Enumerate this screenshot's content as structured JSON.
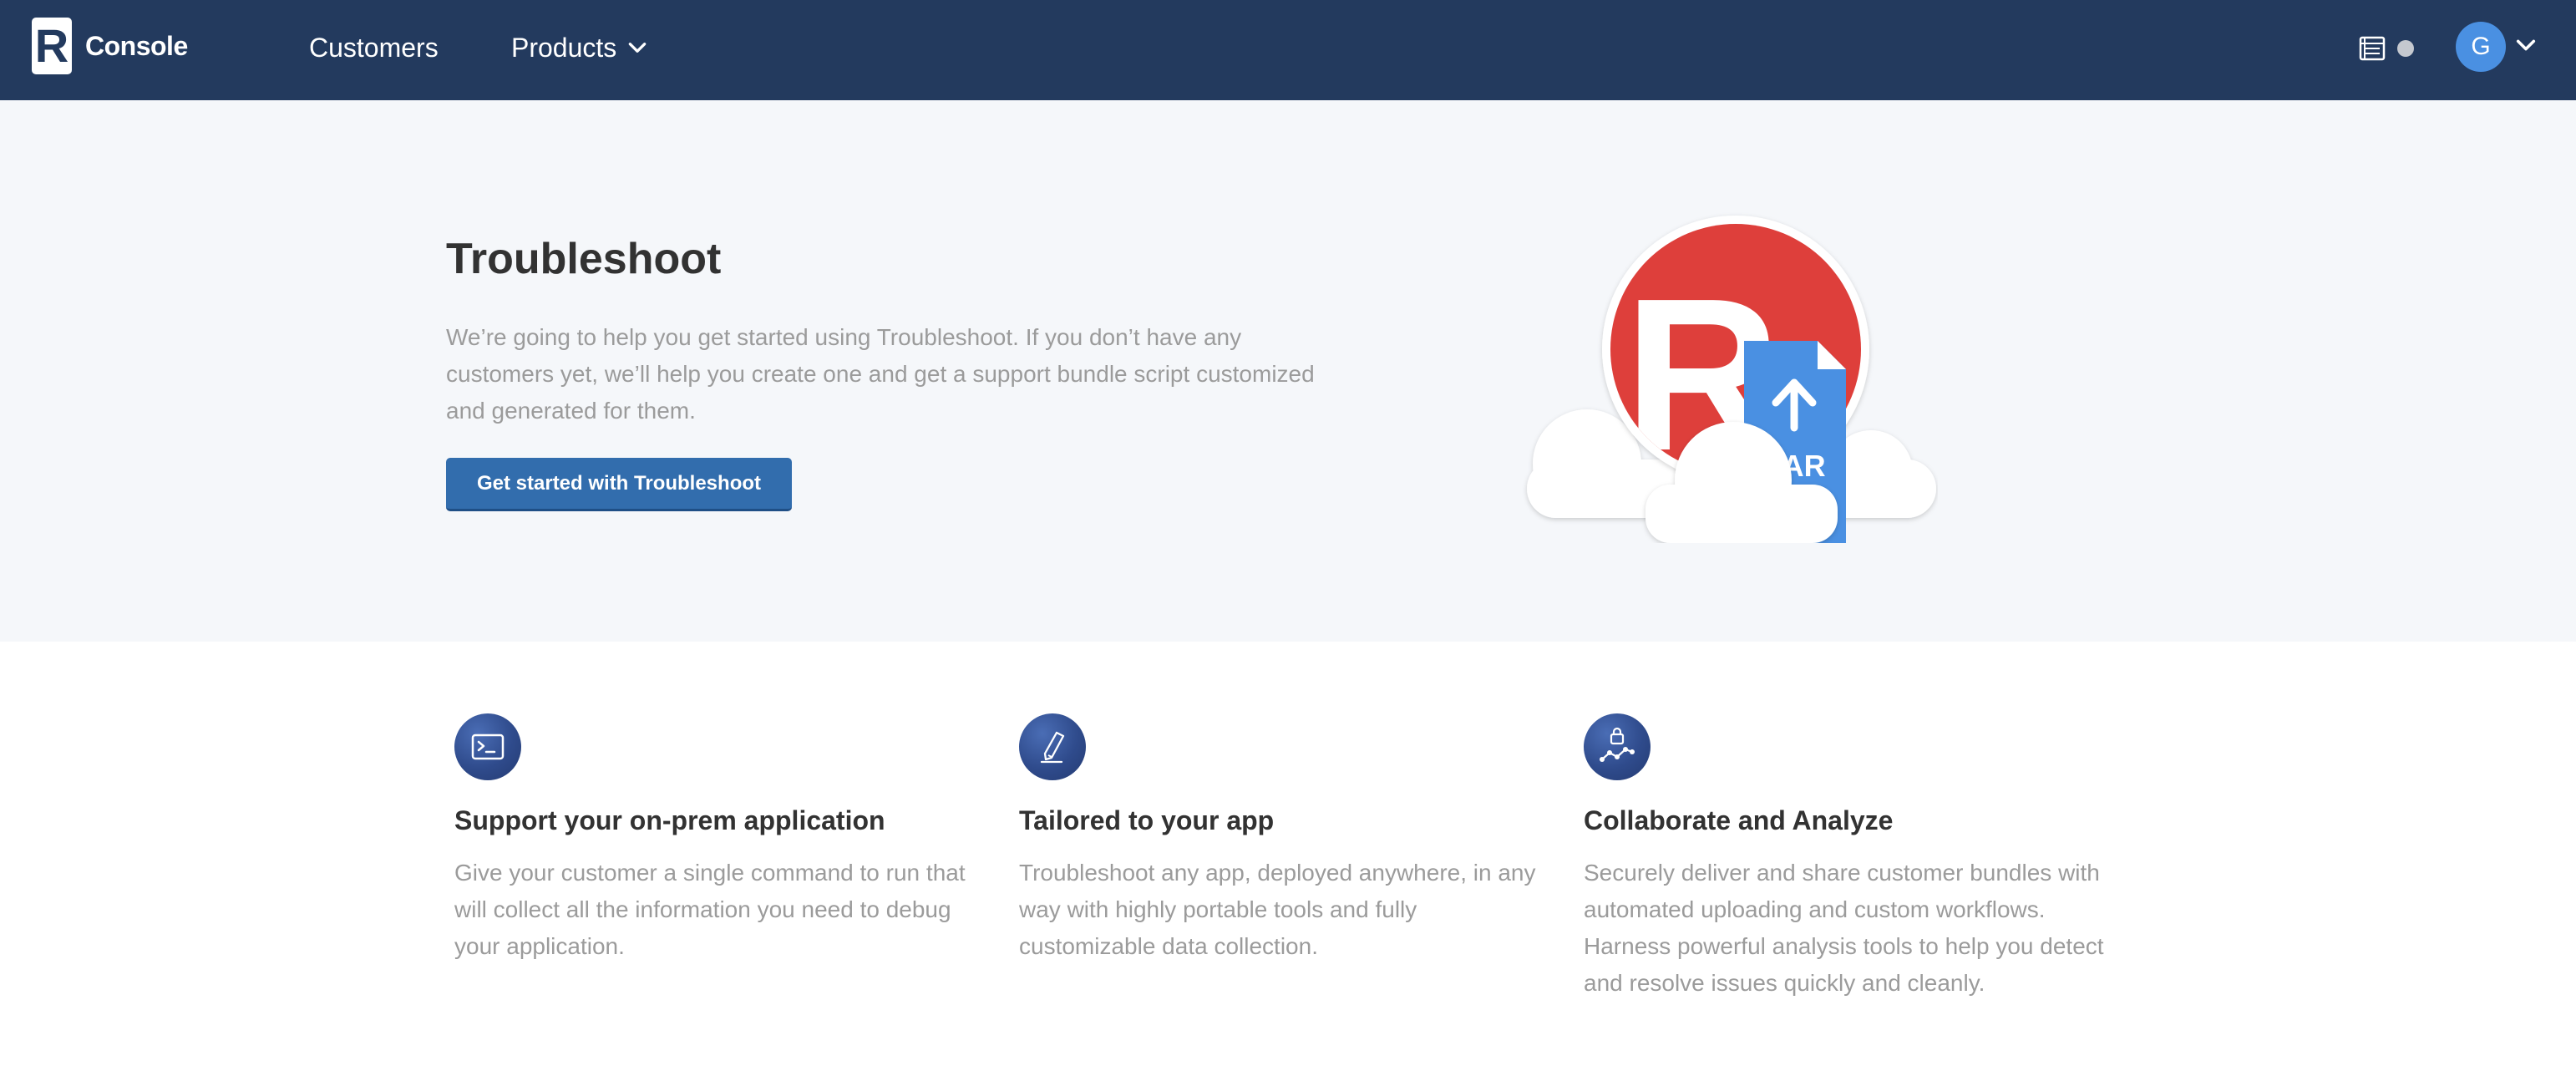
{
  "header": {
    "logo_letter": "R",
    "app_name": "Console",
    "nav": [
      {
        "label": "Customers"
      },
      {
        "label": "Products"
      }
    ],
    "user_initial": "G",
    "icons": [
      "support-bundle-icon",
      "notification-dot",
      "chevron-down-icon"
    ]
  },
  "hero": {
    "title": "Troubleshoot",
    "description": "We’re going to help you get started using Troubleshoot. If you don’t have any customers yet, we’ll help you create one and get a support bundle script customized and generated for them.",
    "button_label": "Get started with Troubleshoot",
    "illustration": {
      "badge_letter": "R",
      "file_label": "TAR",
      "colors": {
        "badge": "#de3f3b",
        "file": "#4a90e2"
      }
    }
  },
  "features": [
    {
      "icon": "terminal-icon",
      "title": "Support your on-prem application",
      "description": "Give your customer a single command to run that will collect all the information you need to debug your application."
    },
    {
      "icon": "pencil-icon",
      "title": "Tailored to your app",
      "description": "Troubleshoot any app, deployed anywhere, in any way with highly portable tools and fully customizable data collection."
    },
    {
      "icon": "secure-analytics-icon",
      "title": "Collaborate and Analyze",
      "description": "Securely deliver and share customer bundles with automated uploading and custom workflows. Harness powerful analysis tools to help you detect and resolve issues quickly and cleanly."
    }
  ],
  "colors": {
    "topbar": "#233a5e",
    "hero_bg": "#f5f7fa",
    "primary_button": "#326dad",
    "muted_text": "#9b9b9b",
    "avatar": "#4a90e2"
  }
}
